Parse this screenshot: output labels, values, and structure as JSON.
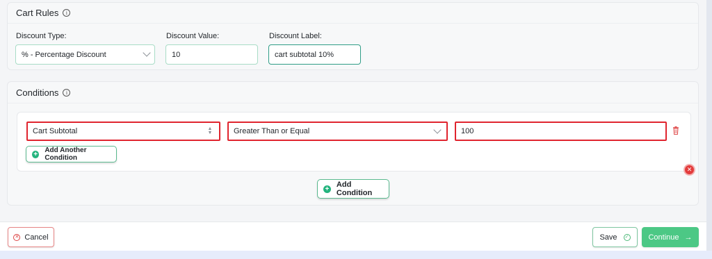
{
  "cart_rules": {
    "title": "Cart Rules",
    "discount_type": {
      "label": "Discount Type:",
      "value": "% - Percentage Discount"
    },
    "discount_value": {
      "label": "Discount Value:",
      "value": "10"
    },
    "discount_label": {
      "label": "Discount Label:",
      "value": "cart subtotal 10%"
    }
  },
  "conditions": {
    "title": "Conditions",
    "rows": [
      {
        "field": "Cart Subtotal",
        "operator": "Greater Than or Equal",
        "value": "100"
      }
    ],
    "add_another_label": "Add Another Condition",
    "add_condition_label": "Add Condition"
  },
  "footer": {
    "cancel_label": "Cancel",
    "save_label": "Save",
    "continue_label": "Continue",
    "continue_arrow": "→"
  },
  "colors": {
    "accent_green": "#4cc885",
    "error_red": "#e0242e"
  },
  "icons": {
    "info": "info-icon",
    "chevron": "chevron-down-icon",
    "updown": "updown-icon",
    "trash": "trash-icon",
    "plus": "plus-circle-icon",
    "remove": "remove-circle-icon",
    "cancel": "x-circle-icon",
    "check": "check-circle-icon"
  }
}
